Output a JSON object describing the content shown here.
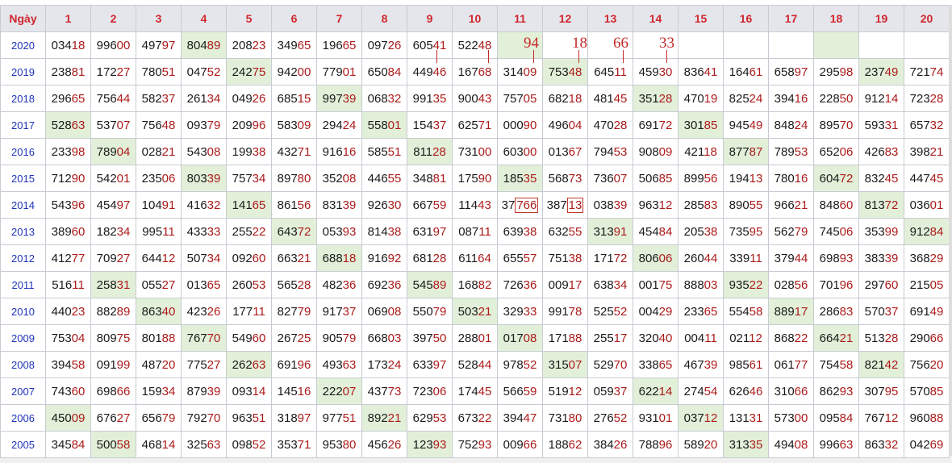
{
  "header": [
    "Ngày",
    "1",
    "2",
    "3",
    "4",
    "5",
    "6",
    "7",
    "8",
    "9",
    "10",
    "11",
    "12",
    "13",
    "14",
    "15",
    "16",
    "17",
    "18",
    "19",
    "20"
  ],
  "rows": [
    {
      "year": "2020",
      "cells": [
        "03418",
        "99600",
        "49797",
        "80489",
        "20823",
        "34965",
        "19665",
        "09726",
        "60541",
        "52248",
        "",
        "",
        "",
        "",
        "",
        "",
        "",
        "",
        "",
        ""
      ],
      "hl": [
        3,
        10,
        17
      ]
    },
    {
      "year": "2019",
      "cells": [
        "23881",
        "17227",
        "78051",
        "04752",
        "24275",
        "94200",
        "77901",
        "65084",
        "44946",
        "16768",
        "31409",
        "75348",
        "64511",
        "45930",
        "83641",
        "16461",
        "65897",
        "29598",
        "23749",
        "72174"
      ],
      "hl": [
        4,
        11,
        18
      ]
    },
    {
      "year": "2018",
      "cells": [
        "29665",
        "75644",
        "58237",
        "26134",
        "04926",
        "68515",
        "99739",
        "06832",
        "99135",
        "90043",
        "75705",
        "68218",
        "48145",
        "35128",
        "47019",
        "82524",
        "39416",
        "22850",
        "91214",
        "72328"
      ],
      "hl": [
        6,
        13
      ]
    },
    {
      "year": "2017",
      "cells": [
        "52863",
        "53707",
        "75648",
        "09379",
        "20996",
        "58309",
        "29424",
        "55801",
        "15437",
        "62571",
        "00090",
        "49604",
        "47028",
        "69172",
        "30185",
        "94549",
        "84824",
        "89570",
        "59331",
        "65732"
      ],
      "hl": [
        0,
        7,
        14
      ]
    },
    {
      "year": "2016",
      "cells": [
        "23398",
        "78904",
        "02821",
        "54308",
        "19938",
        "43271",
        "91616",
        "58551",
        "81128",
        "73100",
        "60300",
        "01367",
        "79453",
        "90809",
        "42118",
        "87787",
        "78953",
        "65206",
        "42683",
        "39821"
      ],
      "hl": [
        1,
        8,
        15
      ]
    },
    {
      "year": "2015",
      "cells": [
        "71290",
        "54201",
        "23506",
        "80339",
        "75734",
        "89780",
        "35208",
        "44655",
        "34881",
        "17590",
        "18535",
        "56873",
        "73607",
        "50685",
        "89956",
        "19413",
        "78016",
        "60472",
        "83245",
        "44745"
      ],
      "hl": [
        3,
        10,
        17
      ]
    },
    {
      "year": "2014",
      "cells": [
        "54396",
        "45497",
        "10491",
        "41632",
        "14165",
        "86156",
        "83139",
        "92630",
        "66759",
        "11443",
        "37766",
        "38713",
        "03839",
        "96312",
        "28583",
        "89055",
        "96621",
        "84860",
        "81372",
        "03601"
      ],
      "hl": [
        4,
        18
      ]
    },
    {
      "year": "2013",
      "cells": [
        "38960",
        "18234",
        "99511",
        "43333",
        "25522",
        "64372",
        "05393",
        "81438",
        "63197",
        "08711",
        "63938",
        "63255",
        "31391",
        "45484",
        "20538",
        "73595",
        "56279",
        "74506",
        "35399",
        "91284"
      ],
      "hl": [
        5,
        12,
        19
      ]
    },
    {
      "year": "2012",
      "cells": [
        "41277",
        "70927",
        "64412",
        "50734",
        "09260",
        "66321",
        "68818",
        "91692",
        "68128",
        "61164",
        "65557",
        "75138",
        "17172",
        "80606",
        "26044",
        "33911",
        "37944",
        "69893",
        "38339",
        "36829"
      ],
      "hl": [
        6,
        13
      ]
    },
    {
      "year": "2011",
      "cells": [
        "51611",
        "25831",
        "05527",
        "01365",
        "26053",
        "56528",
        "48236",
        "69236",
        "54589",
        "16882",
        "72636",
        "00917",
        "63834",
        "00175",
        "88803",
        "93522",
        "02856",
        "70196",
        "29760",
        "21505"
      ],
      "hl": [
        1,
        8,
        15
      ]
    },
    {
      "year": "2010",
      "cells": [
        "44023",
        "88289",
        "86340",
        "42326",
        "17711",
        "82779",
        "91737",
        "06908",
        "55079",
        "50321",
        "32933",
        "99178",
        "52552",
        "00429",
        "23365",
        "55458",
        "88917",
        "28683",
        "57037",
        "69149"
      ],
      "hl": [
        2,
        9,
        16
      ]
    },
    {
      "year": "2009",
      "cells": [
        "75304",
        "80975",
        "80188",
        "76770",
        "54960",
        "26725",
        "90579",
        "66803",
        "39750",
        "28801",
        "01708",
        "17188",
        "25517",
        "32040",
        "00411",
        "02112",
        "86822",
        "66421",
        "51328",
        "29066"
      ],
      "hl": [
        3,
        10,
        17
      ]
    },
    {
      "year": "2008",
      "cells": [
        "39458",
        "09199",
        "48720",
        "77527",
        "26263",
        "69196",
        "49363",
        "17324",
        "63397",
        "52844",
        "97852",
        "31507",
        "52970",
        "33865",
        "46739",
        "98561",
        "06177",
        "75458",
        "82142",
        "75620"
      ],
      "hl": [
        4,
        11,
        18
      ]
    },
    {
      "year": "2007",
      "cells": [
        "74360",
        "69866",
        "15934",
        "87939",
        "09314",
        "14516",
        "22207",
        "43773",
        "72306",
        "17445",
        "56659",
        "51912",
        "05937",
        "62214",
        "27454",
        "62646",
        "31066",
        "86293",
        "30795",
        "57085"
      ],
      "hl": [
        6,
        13
      ]
    },
    {
      "year": "2006",
      "cells": [
        "45009",
        "67627",
        "65679",
        "79270",
        "96351",
        "31897",
        "97751",
        "89221",
        "62953",
        "67322",
        "39447",
        "73180",
        "27652",
        "93101",
        "03712",
        "13131",
        "57300",
        "09584",
        "76712",
        "96088"
      ],
      "hl": [
        0,
        7,
        14
      ]
    },
    {
      "year": "2005",
      "cells": [
        "34584",
        "50058",
        "46814",
        "32563",
        "09852",
        "35371",
        "95380",
        "45626",
        "12393",
        "75293",
        "00966",
        "18862",
        "38426",
        "78896",
        "58920",
        "31335",
        "49408",
        "99663",
        "86332",
        "04269"
      ],
      "hl": [
        1,
        8,
        15
      ]
    }
  ],
  "annotations": [
    "94",
    "18",
    "66",
    "33"
  ]
}
